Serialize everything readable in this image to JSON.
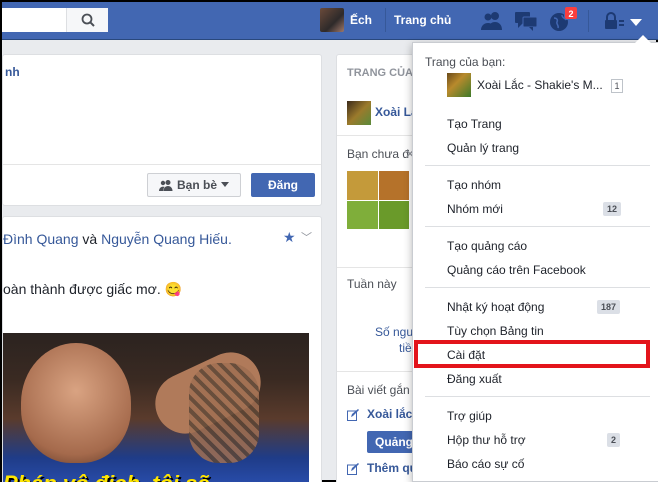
{
  "topbar": {
    "user_name": "Ếch",
    "home_label": "Trang chủ",
    "notification_count": "2"
  },
  "composer": {
    "tab_partial": "nh",
    "audience_label": "Bạn bè",
    "post_label": "Đăng"
  },
  "feed": {
    "names_prefix": "Đình Quang",
    "names_joiner": " và ",
    "names_second": "Nguyễn Quang Hiếu.",
    "text": "oàn thành được giấc mơ. 😋",
    "photo_caption": "Pháp vô địch, tôi sẽ"
  },
  "right": {
    "pages_heading": "TRANG CỦA",
    "page_link": "Xoài Lắ",
    "unseen_heading": "Bạn chưa đ",
    "week_heading": "Tuần này",
    "week_line1": "Số ngu",
    "week_line2": "tiề",
    "posts_heading": "Bài viết gắn",
    "post_link": "Xoài lắc",
    "promote_btn": "Quảng",
    "more_link": "Thêm qu"
  },
  "menu": {
    "heading": "Trang của bạn:",
    "page_name": "Xoài Lắc - Shakie's M...",
    "page_count": "1",
    "items": [
      {
        "label": "Tạo Trang"
      },
      {
        "label": "Quản lý trang"
      },
      {
        "label": "Tạo nhóm"
      },
      {
        "label": "Nhóm mới",
        "count": "12"
      },
      {
        "label": "Tạo quảng cáo"
      },
      {
        "label": "Quảng cáo trên Facebook"
      },
      {
        "label": "Nhật ký hoạt động",
        "count": "187"
      },
      {
        "label": "Tùy chọn Bảng tin"
      },
      {
        "label": "Cài đặt"
      },
      {
        "label": "Đăng xuất"
      },
      {
        "label": "Trợ giúp"
      },
      {
        "label": "Hộp thư hỗ trợ",
        "count": "2"
      },
      {
        "label": "Báo cáo sự cố"
      }
    ]
  },
  "colors": {
    "brand_blue": "#4267b2",
    "link_blue": "#365899",
    "highlight_red": "#e3141b",
    "badge_red": "#fa3e3e"
  }
}
